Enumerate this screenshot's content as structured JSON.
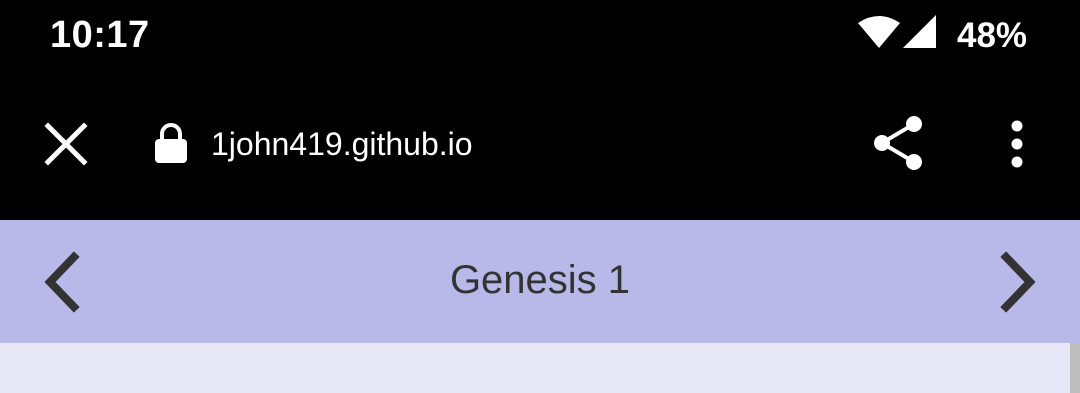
{
  "status_bar": {
    "time": "10:17",
    "battery": "48%",
    "icons": [
      "wifi-icon",
      "signal-icon"
    ]
  },
  "browser": {
    "url": "1john419.github.io",
    "icons": [
      "close-icon",
      "lock-icon",
      "share-icon",
      "more-vert-icon"
    ]
  },
  "nav": {
    "title": "Genesis 1",
    "icons": [
      "chevron-left-icon",
      "chevron-right-icon"
    ],
    "background": "#b8b8e9"
  },
  "colors": {
    "toolbar": "#000000",
    "nav_bar": "#b8b8e9",
    "content_bg": "#e8e7f7",
    "title_text": "#333333"
  }
}
